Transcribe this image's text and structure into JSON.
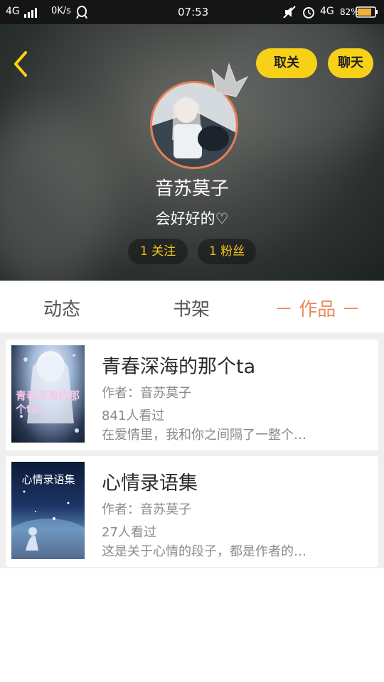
{
  "status_bar": {
    "left_network": "4G",
    "speed": "0K/s",
    "time": "07:53",
    "right_network": "4G",
    "battery": "82%"
  },
  "header": {
    "unfollow_label": "取关",
    "chat_label": "聊天"
  },
  "profile": {
    "name": "音苏莫子",
    "bio": "会好好的♡",
    "following": "1 关注",
    "followers": "1 粉丝"
  },
  "tabs": [
    {
      "label": "动态"
    },
    {
      "label": "书架"
    },
    {
      "label": "－ 作品 －",
      "active": true
    }
  ],
  "books": [
    {
      "title": "青春深海的那个ta",
      "author": "作者：音苏莫子",
      "views": "841人看过",
      "excerpt": "在爱情里，我和你之间隔了一整个…",
      "cover_text": "青春深海的那个ta"
    },
    {
      "title": "心情录语集",
      "author": "作者：音苏莫子",
      "views": "27人看过",
      "excerpt": "这是关于心情的段子，都是作者的…",
      "cover_text": "心情录语集"
    }
  ],
  "colors": {
    "accent_yellow": "#f7d118",
    "active_tab": "#ec8a5b",
    "avatar_border": "#e97e4f"
  }
}
